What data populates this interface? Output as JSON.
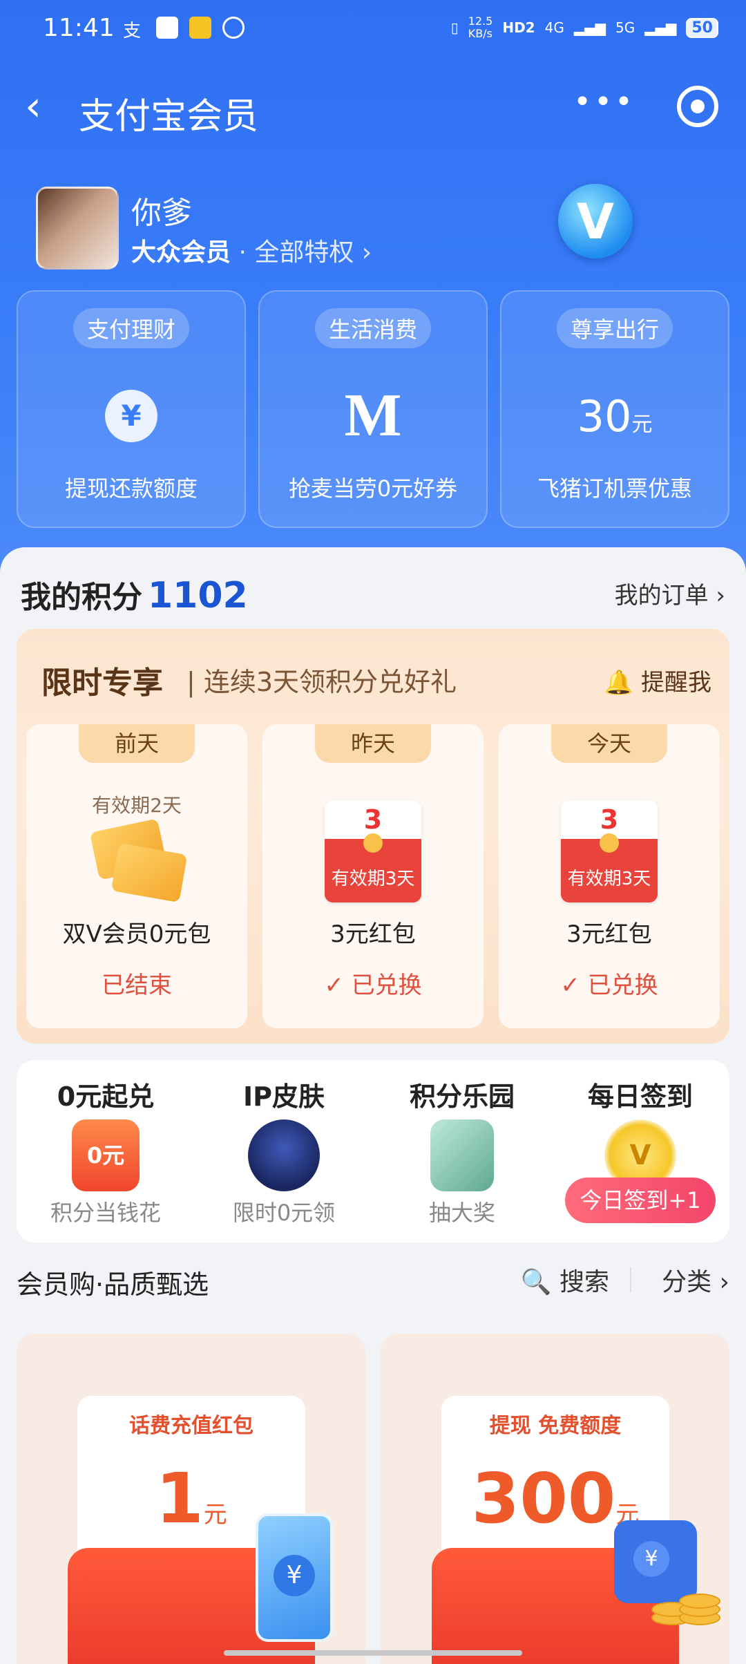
{
  "status_bar": {
    "time": "11:41",
    "net_speed": "12.5\nKB/s",
    "hd": "HD2",
    "sig1": "4G",
    "sig2": "5G",
    "battery": "50"
  },
  "nav": {
    "title": "支付宝会员",
    "more": "•••"
  },
  "profile": {
    "name": "你爹",
    "level": "大众会员",
    "separator": " · ",
    "privilege": "全部特权 ›",
    "badge": "V"
  },
  "benefits": [
    {
      "tag": "支付理财",
      "icon": "yen-icon",
      "glyph": "¥",
      "desc": "提现还款额度"
    },
    {
      "tag": "生活消费",
      "icon": "mcdonalds-icon",
      "glyph": "M",
      "desc": "抢麦当劳0元好券"
    },
    {
      "tag": "尊享出行",
      "icon": "value-30",
      "num": "30",
      "unit": "元",
      "desc": "飞猪订机票优惠"
    }
  ],
  "points": {
    "label": "我的积分",
    "value": "1102",
    "orders": "我的订单 ›"
  },
  "limited": {
    "title": "限时专享",
    "subtitle": "| 连续3天领积分兑好礼",
    "remind": "🔔 提醒我",
    "days": [
      {
        "tab": "前天",
        "validity": "有效期2天",
        "name": "双V会员0元包",
        "status": "已结束"
      },
      {
        "tab": "昨天",
        "rp_num": "3",
        "rp_text": "有效期3天",
        "name": "3元红包",
        "status": "✓ 已兑换"
      },
      {
        "tab": "今天",
        "rp_num": "3",
        "rp_text": "有效期3天",
        "name": "3元红包",
        "status": "✓ 已兑换"
      }
    ]
  },
  "quick": [
    {
      "title": "0元起兑",
      "sub": "积分当钱花",
      "icon": "red-envelope-icon",
      "icon_text": "0元"
    },
    {
      "title": "IP皮肤",
      "sub": "限时0元领",
      "icon": "mickey-icon"
    },
    {
      "title": "积分乐园",
      "sub": "抽大奖",
      "icon": "phone-prize-icon"
    },
    {
      "title": "每日签到",
      "btn": "今日签到+1",
      "icon": "v-coin-icon",
      "icon_text": "V"
    }
  ],
  "shop": {
    "title": "会员购·品质甄选",
    "search": "🔍 搜索",
    "category": "分类 ›"
  },
  "products": [
    {
      "tag": "话费充值红包",
      "num": "1",
      "unit": "元",
      "icon": "phone-icon",
      "glyph": "¥"
    },
    {
      "tag": "提现 免费额度",
      "num": "300",
      "unit": "元",
      "icon": "wallet-icon",
      "glyph": "¥"
    }
  ]
}
